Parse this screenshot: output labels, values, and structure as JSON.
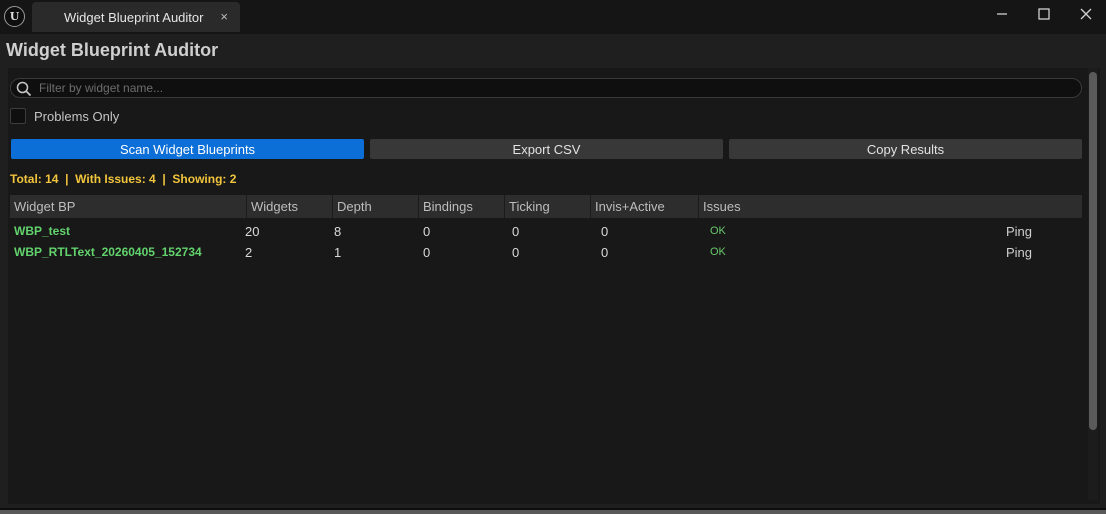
{
  "window": {
    "tab_title": "Widget Blueprint Auditor",
    "tab_close": "×",
    "logo_text": "U"
  },
  "app": {
    "title": "Widget Blueprint Auditor"
  },
  "search": {
    "placeholder": "Filter by widget name...",
    "value": ""
  },
  "filters": {
    "problems_only_label": "Problems Only",
    "problems_only_checked": false
  },
  "toolbar": {
    "scan_label": "Scan Widget Blueprints",
    "export_label": "Export CSV",
    "copy_label": "Copy Results"
  },
  "summary": {
    "text": "Total: 14  |  With Issues: 4  |  Showing: 2",
    "color": "#f2c53d"
  },
  "table": {
    "columns": [
      "Widget BP",
      "Widgets",
      "Depth",
      "Bindings",
      "Ticking",
      "Invis+Active",
      "Issues"
    ],
    "rows": [
      {
        "name": "WBP_test",
        "widgets": "20",
        "depth": "8",
        "bindings": "0",
        "ticking": "0",
        "invis_active": "0",
        "issues": "OK",
        "action": "Ping"
      },
      {
        "name": "WBP_RTLText_20260405_152734",
        "widgets": "2",
        "depth": "1",
        "bindings": "0",
        "ticking": "0",
        "invis_active": "0",
        "issues": "OK",
        "action": "Ping"
      }
    ]
  },
  "colors": {
    "accent": "#0c6fd7",
    "ok": "#69c96b",
    "name": "#62d36d"
  }
}
